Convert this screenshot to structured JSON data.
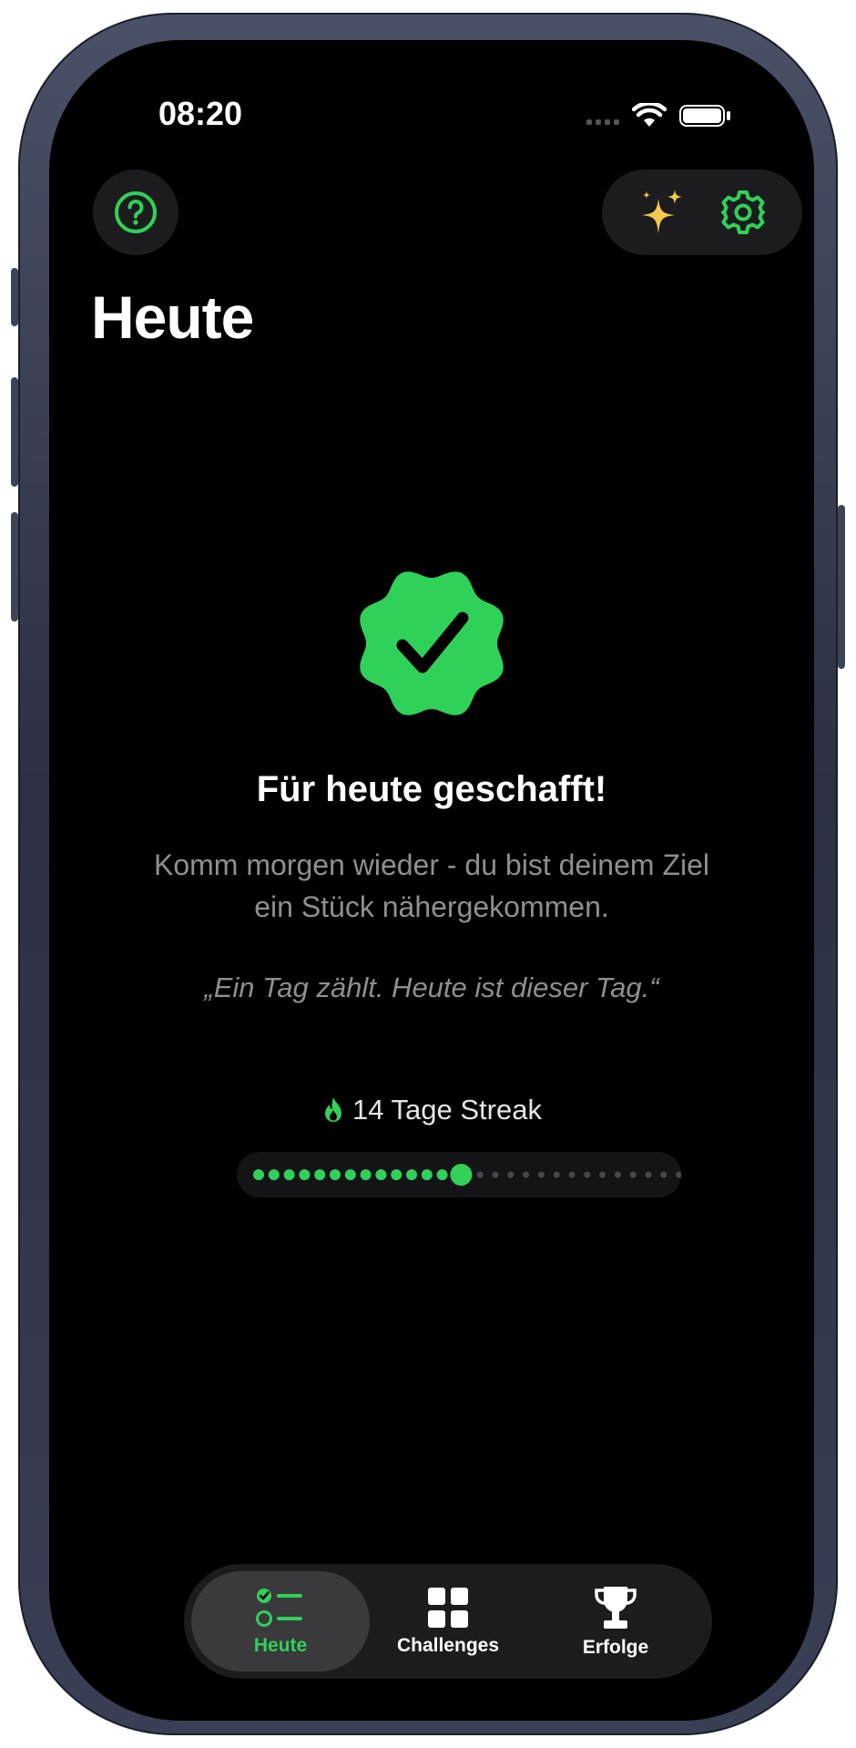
{
  "status_bar": {
    "time": "08:20"
  },
  "header": {
    "title": "Heute",
    "help_icon": "question-mark-circle-icon",
    "sparkles_icon": "sparkles-icon",
    "settings_icon": "gear-icon"
  },
  "completion": {
    "title": "Für heute geschafft!",
    "subtitle": "Komm morgen wieder - du bist deinem Ziel ein Stück nähergekommen.",
    "quote": "„Ein Tag zählt. Heute ist dieser Tag.“",
    "icon": "checkmark-seal-icon"
  },
  "streak": {
    "label": "14 Tage Streak",
    "days_done": 14,
    "days_total": 30,
    "icon": "flame-icon"
  },
  "tabbar": {
    "tabs": [
      {
        "label": "Heute",
        "icon": "checklist-icon",
        "active": true
      },
      {
        "label": "Challenges",
        "icon": "grid-icon",
        "active": false
      },
      {
        "label": "Erfolge",
        "icon": "trophy-icon",
        "active": false
      }
    ]
  },
  "colors": {
    "accent": "#30D158",
    "sparkle": "#F2C94C",
    "background": "#000000",
    "secondary_text": "#8E8E93"
  }
}
